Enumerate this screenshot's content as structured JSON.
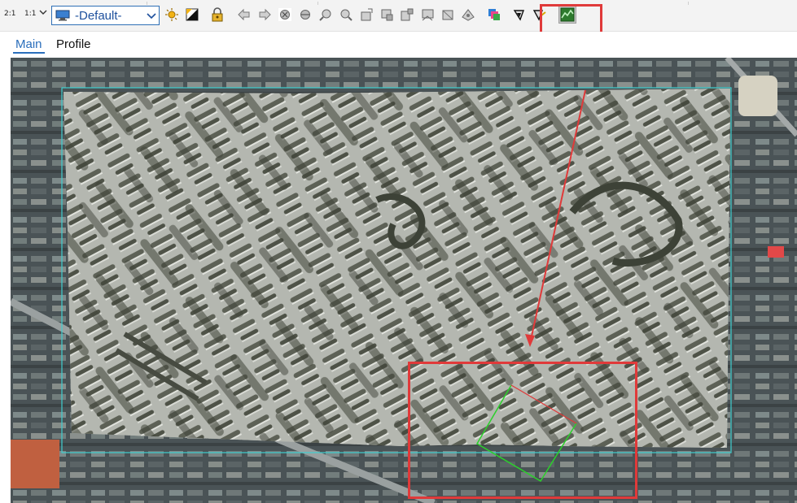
{
  "toolbar": {
    "zoom_2_1": "2:1",
    "zoom_1_1": "1:1",
    "style_value": "-Default-"
  },
  "tabs": [
    {
      "label": "Main"
    },
    {
      "label": "Profile"
    }
  ],
  "colors": {
    "highlight": "#e03a3a",
    "dem_surface": "#b4b7b0",
    "extent_line": "#3fcfd0",
    "profile_line": "#2bd12b",
    "tab_active": "#2a6ebb"
  }
}
